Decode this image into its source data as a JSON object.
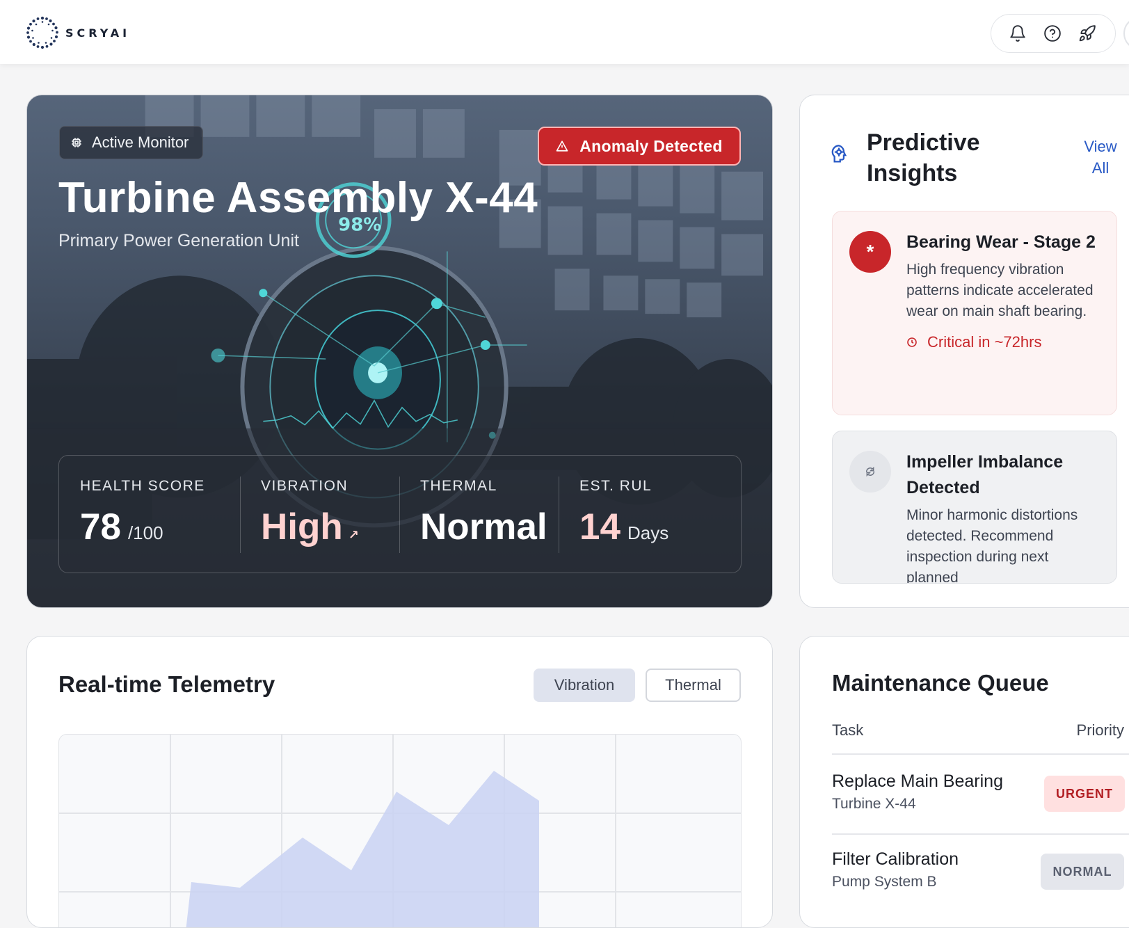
{
  "brand": {
    "name": "SCRYAI"
  },
  "header": {
    "actions": [
      {
        "icon": "bell-icon"
      },
      {
        "icon": "help-circle-icon"
      },
      {
        "icon": "rocket-icon"
      }
    ]
  },
  "hero": {
    "status_chip": "Active Monitor",
    "alert_chip": "Anomaly Detected",
    "title": "Turbine Assembly X-44",
    "subtitle": "Primary Power Generation Unit",
    "overlay_percent": "98%",
    "metrics": [
      {
        "label": "HEALTH SCORE",
        "value": "78",
        "unit": "/100"
      },
      {
        "label": "VIBRATION",
        "value": "High",
        "trend": "↗"
      },
      {
        "label": "THERMAL",
        "value": "Normal"
      },
      {
        "label": "EST. RUL",
        "value": "14",
        "unit": "Days"
      }
    ]
  },
  "insights": {
    "title": "Predictive Insights",
    "view_all": "View All",
    "items": [
      {
        "severity": "critical",
        "title": "Bearing Wear - Stage 2",
        "description": "High frequency vibration patterns indicate accelerated wear on main shaft bearing.",
        "eta": "Critical in ~72hrs"
      },
      {
        "severity": "warning",
        "title": "Impeller Imbalance Detected",
        "description": "Minor harmonic distortions detected. Recommend inspection during next planned"
      }
    ]
  },
  "telemetry": {
    "title": "Real-time Telemetry",
    "tabs": [
      "Vibration",
      "Thermal"
    ],
    "active_tab": "Vibration",
    "colors": {
      "fill": "#c9d2f2",
      "grid": "#e2e4e8"
    }
  },
  "maintenance": {
    "title": "Maintenance Queue",
    "columns": [
      "Task",
      "Priority"
    ],
    "rows": [
      {
        "task": "Replace Main Bearing",
        "asset": "Turbine X-44",
        "priority": "URGENT"
      },
      {
        "task": "Filter Calibration",
        "asset": "Pump System B",
        "priority": "NORMAL"
      }
    ]
  },
  "colors": {
    "accent_blue": "#2859c5",
    "danger": "#c8262a",
    "hero_dark": "#2f3641"
  }
}
